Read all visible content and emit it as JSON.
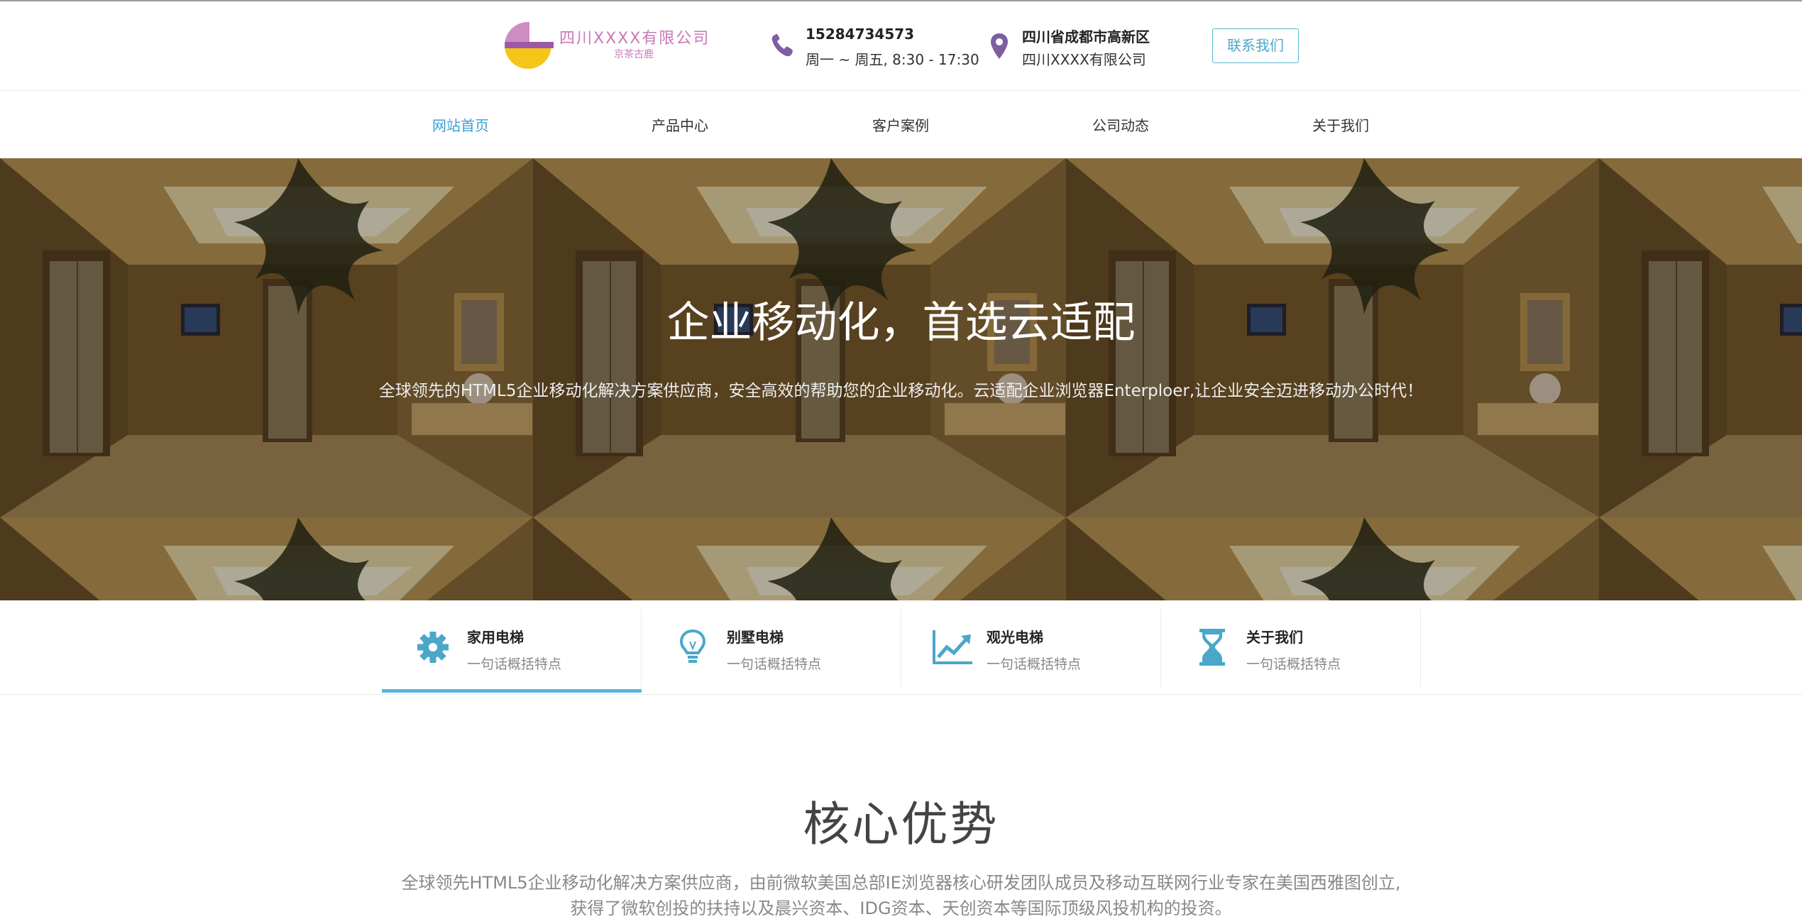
{
  "header": {
    "logo": {
      "name": "四川XXXX有限公司",
      "tagline": "京茶古鹿",
      "colors": {
        "top": "#cf8cc3",
        "band": "#9b59a8",
        "bottom": "#f5c518"
      }
    },
    "phone": {
      "number": "15284734573",
      "hours": "周一 ~ 周五, 8:30 - 17:30",
      "icon": "phone-icon"
    },
    "address": {
      "region": "四川省成都市高新区",
      "company": "四川XXXX有限公司",
      "icon": "map-pin-icon"
    },
    "contact_button": "联系我们"
  },
  "nav": {
    "items": [
      {
        "label": "网站首页",
        "active": true
      },
      {
        "label": "产品中心"
      },
      {
        "label": "客户案例"
      },
      {
        "label": "公司动态"
      },
      {
        "label": "关于我们"
      }
    ]
  },
  "hero": {
    "title": "企业移动化，首选云适配",
    "subtitle": "全球领先的HTML5企业移动化解决方案供应商，安全高效的帮助您的企业移动化。云适配企业浏览器Enterploer,让企业安全迈进移动办公时代！"
  },
  "features": [
    {
      "title": "家用电梯",
      "desc": "一句话概括特点",
      "icon": "gear-icon",
      "active": true
    },
    {
      "title": "别墅电梯",
      "desc": "一句话概括特点",
      "icon": "lightbulb-icon"
    },
    {
      "title": "观光电梯",
      "desc": "一句话概括特点",
      "icon": "trend-chart-icon"
    },
    {
      "title": "关于我们",
      "desc": "一句话概括特点",
      "icon": "hourglass-icon"
    }
  ],
  "core": {
    "title": "核心优势",
    "description": "全球领先HTML5企业移动化解决方案供应商，由前微软美国总部IE浏览器核心研发团队成员及移动互联网行业专家在美国西雅图创立,获得了微软创投的扶持以及晨兴资本、IDG资本、天创资本等国际顶级风投机构的投资。"
  },
  "colors": {
    "accent": "#3a9fd6",
    "feature_accent": "#56b7d8",
    "icon_purple": "#7d5ea3"
  }
}
